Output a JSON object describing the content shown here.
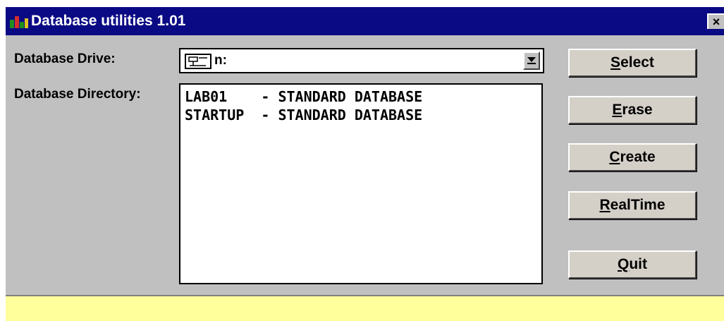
{
  "window": {
    "title": "Database utilities 1.01",
    "close_glyph": "×",
    "app_icon": "database-utilities-app-icon"
  },
  "drive": {
    "label": "Database Drive:",
    "value": "n:",
    "icon": "network-drive-icon",
    "dropdown_icon": "chevron-down-icon"
  },
  "directory": {
    "label": "Database Directory:",
    "entries": [
      "LAB01    - STANDARD DATABASE",
      "STARTUP  - STANDARD DATABASE"
    ]
  },
  "buttons": [
    {
      "mnemonic": "S",
      "rest": "elect"
    },
    {
      "mnemonic": "E",
      "rest": "rase"
    },
    {
      "mnemonic": "C",
      "rest": "reate"
    },
    {
      "mnemonic": "R",
      "rest": "ealTime"
    },
    {
      "mnemonic": "Q",
      "rest": "uit"
    }
  ],
  "colors": {
    "titlebar": "#0a0a84",
    "face": "#c0c0c0",
    "status_bar": "#ffff9c"
  }
}
